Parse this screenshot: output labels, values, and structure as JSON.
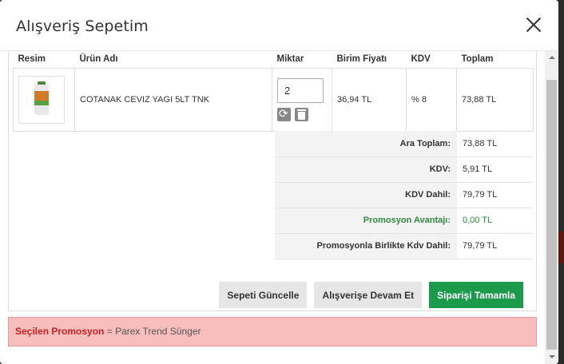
{
  "modal": {
    "title": "Alışveriş Sepetim"
  },
  "table": {
    "headers": {
      "image": "Resim",
      "product": "Ürün Adı",
      "quantity": "Miktar",
      "unit_price": "Birim Fiyatı",
      "vat": "KDV",
      "total": "Toplam"
    },
    "rows": [
      {
        "product_name": "COTANAK CEVIZ YAGI 5LT TNK",
        "quantity": "2",
        "unit_price": "36,94 TL",
        "vat": "% 8",
        "total": "73,88 TL"
      }
    ]
  },
  "totals": {
    "subtotal_label": "Ara Toplam:",
    "subtotal_value": "73,88 TL",
    "vat_label": "KDV:",
    "vat_value": "5,91 TL",
    "vat_included_label": "KDV Dahil:",
    "vat_included_value": "79,79 TL",
    "promo_advantage_label": "Promosyon Avantajı:",
    "promo_advantage_value": "0,00 TL",
    "promo_total_label": "Promosyonla Birlikte Kdv Dahil:",
    "promo_total_value": "79,79 TL"
  },
  "buttons": {
    "update_cart": "Sepeti Güncelle",
    "continue_shopping": "Alışverişe Devam Et",
    "complete_order": "Siparişi Tamamla"
  },
  "promotion": {
    "label": "Seçilen Promosyon",
    "separator": " = ",
    "value": "Parex Trend Sünger"
  },
  "colors": {
    "accent_green": "#1a9a4a",
    "promo_text_green": "#2e8b3e",
    "promo_bar_bg": "#f8bdbd",
    "promo_label_red": "#d02020"
  }
}
